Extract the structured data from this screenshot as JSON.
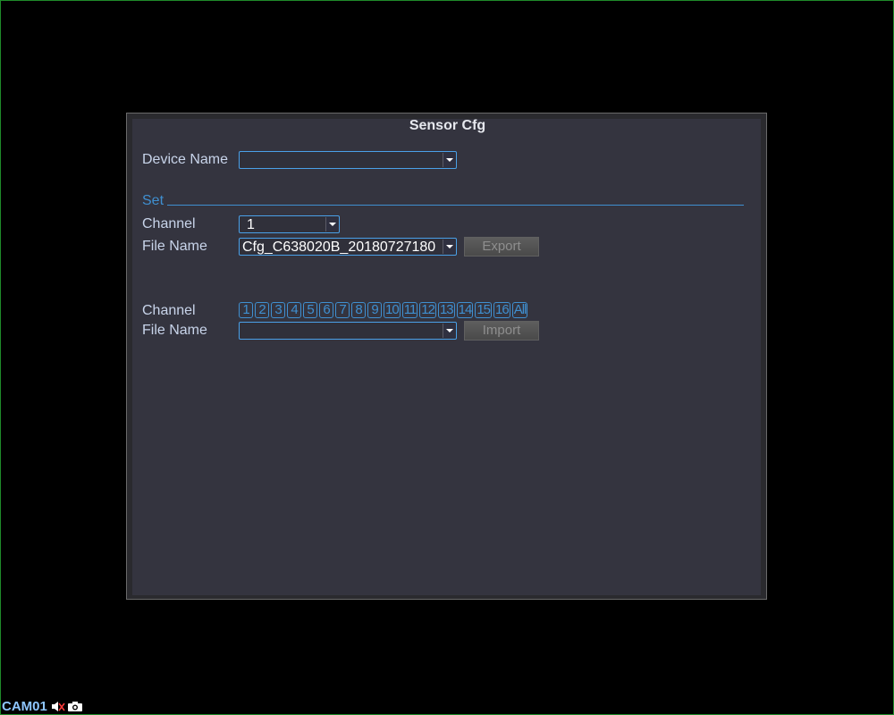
{
  "dialog": {
    "title": "Sensor Cfg"
  },
  "device": {
    "label": "Device Name",
    "value": ""
  },
  "set_section": {
    "label": "Set",
    "channel_label": "Channel",
    "channel_value": "1",
    "file_label": "File Name",
    "file_value": "Cfg_C638020B_20180727180",
    "export_label": "Export"
  },
  "import_section": {
    "channel_label": "Channel",
    "channels": [
      "1",
      "2",
      "3",
      "4",
      "5",
      "6",
      "7",
      "8",
      "9",
      "10",
      "11",
      "12",
      "13",
      "14",
      "15",
      "16",
      "All"
    ],
    "file_label": "File Name",
    "file_value": "",
    "import_label": "Import"
  },
  "status_bar": {
    "camera": "CAM01",
    "icons": [
      "mute-icon",
      "camera-icon"
    ]
  },
  "colors": {
    "background": "#000000",
    "panel": "#34343f",
    "accent": "#3f8fd0",
    "label": "#c8d4ea",
    "screen_border": "#1f8a2a"
  }
}
